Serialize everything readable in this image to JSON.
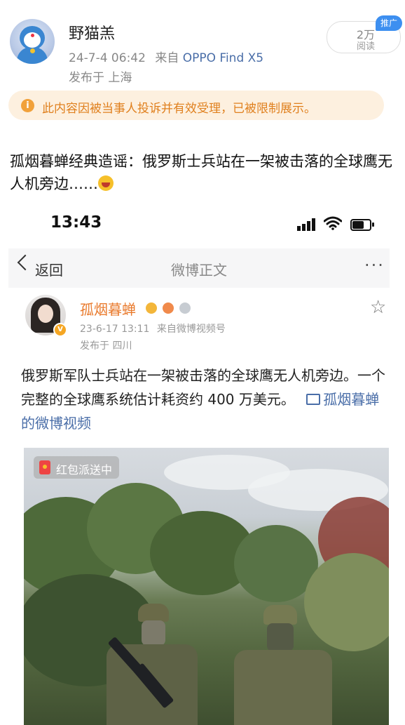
{
  "outer_post": {
    "username": "野猫羔",
    "timestamp": "24-7-4 06:42",
    "source_prefix": "来自",
    "device": "OPPO Find X5",
    "location": "发布于 上海",
    "views_count": "2万",
    "views_label": "阅读",
    "promo_tag": "推广",
    "notice_icon": "i",
    "notice_text": "此内容因被当事人投诉并有效受理，已被限制展示。",
    "text": "孤烟暮蝉经典造谣：俄罗斯士兵站在一架被击落的全球鹰无人机旁边……"
  },
  "embedded": {
    "status_time": "13:43",
    "nav_back": "返回",
    "nav_title": "微博正文",
    "nav_more": "···",
    "author": "孤烟暮蝉",
    "timestamp": "23-6-17 13:11",
    "source": "来自微博视频号",
    "location": "发布于 四川",
    "verified_mark": "V",
    "text": "俄罗斯军队士兵站在一架被击落的全球鹰无人机旁边。一个完整的全球鹰系统估计耗资约 400 万美元。",
    "video_link": "孤烟暮蝉的微博视频",
    "red_packet": "红包派送中"
  },
  "icons": {
    "star": "☆"
  },
  "colors": {
    "accent_orange": "#e97a2c",
    "link_blue": "#4a6ea8",
    "notice_bg": "#fdf0df",
    "promo_blue": "#3d8ff0"
  }
}
